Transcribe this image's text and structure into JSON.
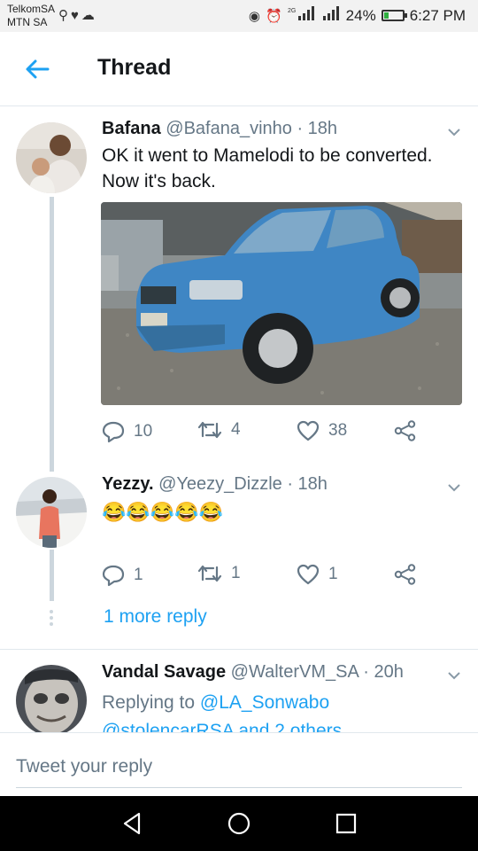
{
  "status_bar": {
    "carrier_1": "TelkomSA",
    "carrier_2": "MTN SA",
    "network_label": "2G",
    "battery_percent": "24%",
    "battery_level": 0.24,
    "time": "6:27 PM",
    "icons": [
      "usb-icon",
      "heart-icon",
      "cloud-icon",
      "data-saver-icon",
      "alarm-icon",
      "signal-icon",
      "signal-icon",
      "battery-icon"
    ]
  },
  "header": {
    "title": "Thread",
    "back_icon": "arrow-left-icon"
  },
  "tweets": [
    {
      "name": "Bafana",
      "handle": "@Bafana_vinho",
      "time": "· 18h",
      "text_line_1": "OK it went to Mamelodi to be converted.",
      "text_line_2": "Now it's back.",
      "image_alt": "blue-pickup-truck-photo",
      "replies": "10",
      "retweets": "4",
      "likes": "38"
    },
    {
      "name": "Yezzy.",
      "handle": "@Yeezy_Dizzle",
      "time": "· 18h",
      "text": "😂😂😂😂😂",
      "replies": "1",
      "retweets": "1",
      "likes": "1"
    },
    {
      "name": "Vandal Savage",
      "handle": "@WalterVM_SA",
      "time": "· 20h",
      "replying_prefix": "Replying to",
      "replying_user": "@LA_Sonwabo",
      "replying_line_2": "@stolencarRSA and 2 others"
    }
  ],
  "more_replies": "1 more reply",
  "composer": {
    "placeholder": "Tweet your reply"
  },
  "colors": {
    "accent": "#1da1f2",
    "muted": "#657786",
    "text": "#14171a",
    "thread_line": "#ccd6dd"
  }
}
